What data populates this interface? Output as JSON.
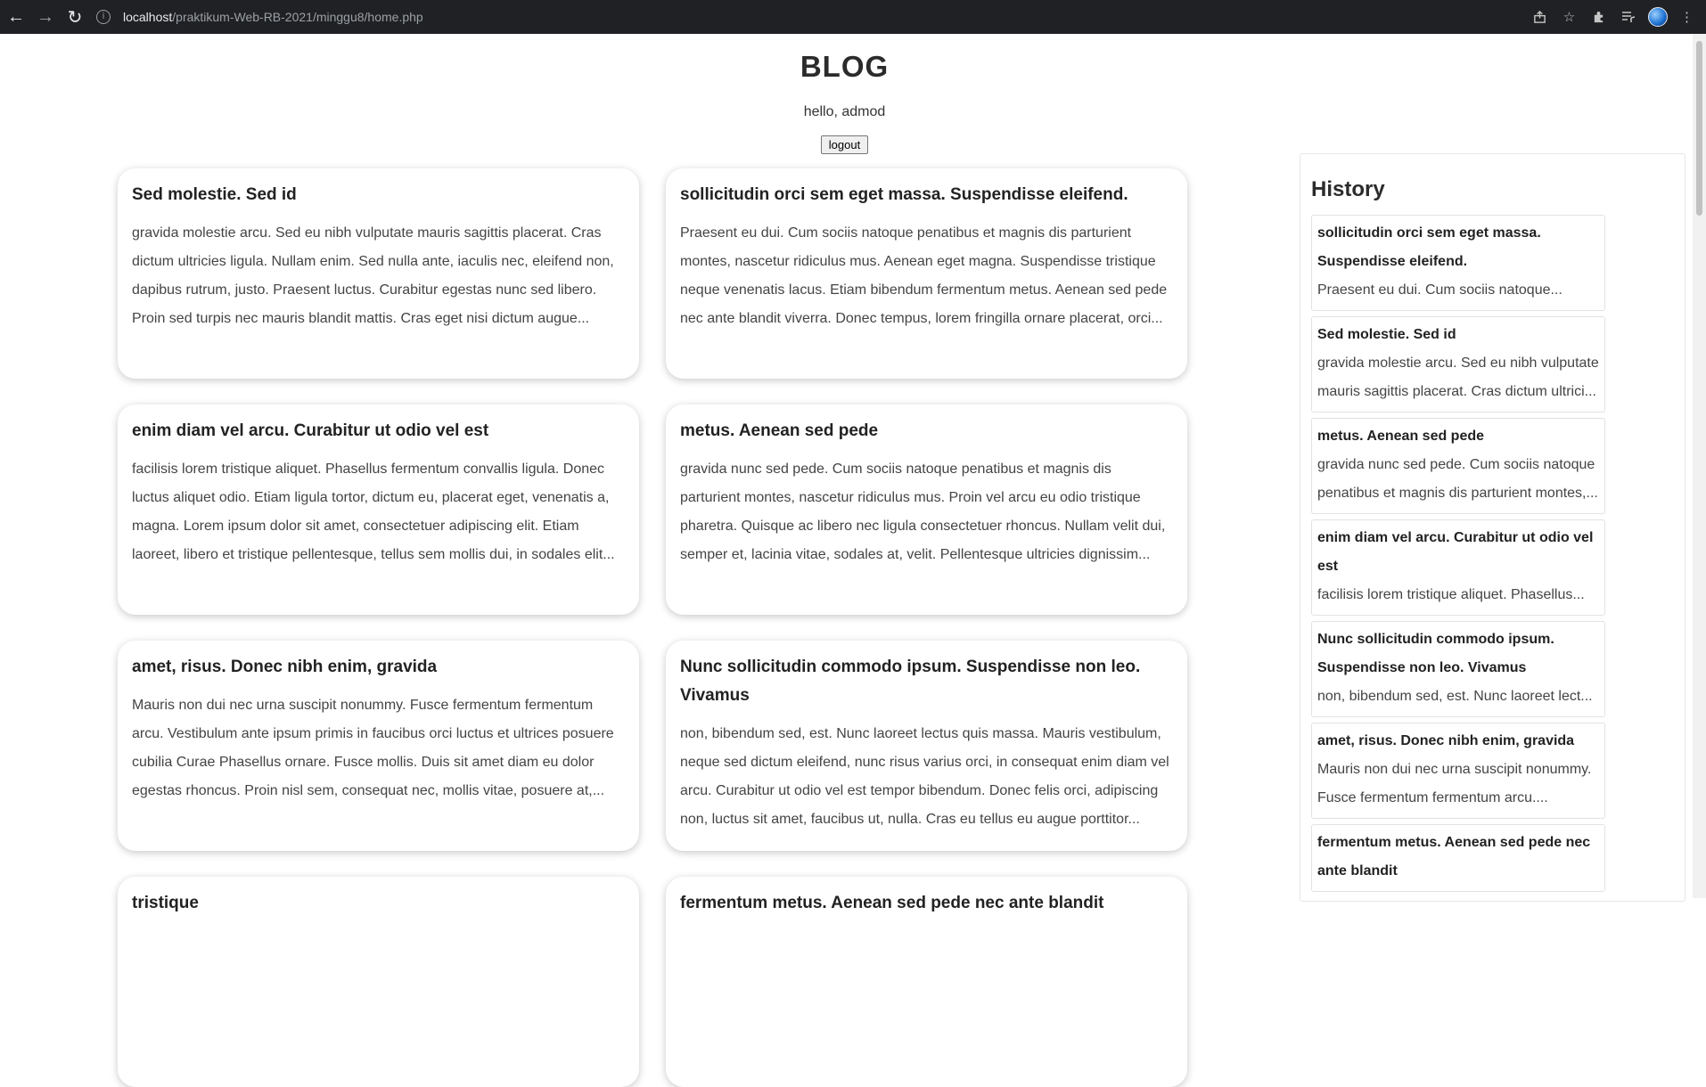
{
  "browser": {
    "url_host": "localhost",
    "url_path": "/praktikum-Web-RB-2021/minggu8/home.php"
  },
  "header": {
    "title": "BLOG",
    "greeting": "hello, admod",
    "logout_label": "logout"
  },
  "posts": [
    {
      "title": "Sed molestie. Sed id",
      "body": "gravida molestie arcu. Sed eu nibh vulputate mauris sagittis placerat. Cras dictum ultricies ligula. Nullam enim. Sed nulla ante, iaculis nec, eleifend non, dapibus rutrum, justo. Praesent luctus. Curabitur egestas nunc sed libero. Proin sed turpis nec mauris blandit mattis. Cras eget nisi dictum augue..."
    },
    {
      "title": "sollicitudin orci sem eget massa. Suspendisse eleifend.",
      "body": "Praesent eu dui. Cum sociis natoque penatibus et magnis dis parturient montes, nascetur ridiculus mus. Aenean eget magna. Suspendisse tristique neque venenatis lacus. Etiam bibendum fermentum metus. Aenean sed pede nec ante blandit viverra. Donec tempus, lorem fringilla ornare placerat, orci..."
    },
    {
      "title": "enim diam vel arcu. Curabitur ut odio vel est",
      "body": "facilisis lorem tristique aliquet. Phasellus fermentum convallis ligula. Donec luctus aliquet odio. Etiam ligula tortor, dictum eu, placerat eget, venenatis a, magna. Lorem ipsum dolor sit amet, consectetuer adipiscing elit. Etiam laoreet, libero et tristique pellentesque, tellus sem mollis dui, in sodales elit..."
    },
    {
      "title": "metus. Aenean sed pede",
      "body": "gravida nunc sed pede. Cum sociis natoque penatibus et magnis dis parturient montes, nascetur ridiculus mus. Proin vel arcu eu odio tristique pharetra. Quisque ac libero nec ligula consectetuer rhoncus. Nullam velit dui, semper et, lacinia vitae, sodales at, velit. Pellentesque ultricies dignissim..."
    },
    {
      "title": "amet, risus. Donec nibh enim, gravida",
      "body": "Mauris non dui nec urna suscipit nonummy. Fusce fermentum fermentum arcu. Vestibulum ante ipsum primis in faucibus orci luctus et ultrices posuere cubilia Curae Phasellus ornare. Fusce mollis. Duis sit amet diam eu dolor egestas rhoncus. Proin nisl sem, consequat nec, mollis vitae, posuere at,..."
    },
    {
      "title": "Nunc sollicitudin commodo ipsum. Suspendisse non leo. Vivamus",
      "body": "non, bibendum sed, est. Nunc laoreet lectus quis massa. Mauris vestibulum, neque sed dictum eleifend, nunc risus varius orci, in consequat enim diam vel arcu. Curabitur ut odio vel est tempor bibendum. Donec felis orci, adipiscing non, luctus sit amet, faucibus ut, nulla. Cras eu tellus eu augue porttitor..."
    },
    {
      "title": "tristique",
      "body": ""
    },
    {
      "title": "fermentum metus. Aenean sed pede nec ante blandit",
      "body": ""
    }
  ],
  "history": {
    "title": "History",
    "items": [
      {
        "title": "sollicitudin orci sem eget massa. Suspendisse eleifend.",
        "body": "Praesent eu dui. Cum sociis natoque..."
      },
      {
        "title": "Sed molestie. Sed id",
        "body": "gravida molestie arcu. Sed eu nibh vulputate mauris sagittis placerat. Cras dictum ultrici..."
      },
      {
        "title": "metus. Aenean sed pede",
        "body": "gravida nunc sed pede. Cum sociis natoque penatibus et magnis dis parturient montes,..."
      },
      {
        "title": "enim diam vel arcu. Curabitur ut odio vel est",
        "body": "facilisis lorem tristique aliquet. Phasellus..."
      },
      {
        "title": "Nunc sollicitudin commodo ipsum. Suspendisse non leo. Vivamus",
        "body": "non, bibendum sed, est. Nunc laoreet lect..."
      },
      {
        "title": "amet, risus. Donec nibh enim, gravida",
        "body": "Mauris non dui nec urna suscipit nonummy. Fusce fermentum fermentum arcu...."
      },
      {
        "title": "fermentum metus. Aenean sed pede nec ante blandit",
        "body": ""
      }
    ]
  }
}
